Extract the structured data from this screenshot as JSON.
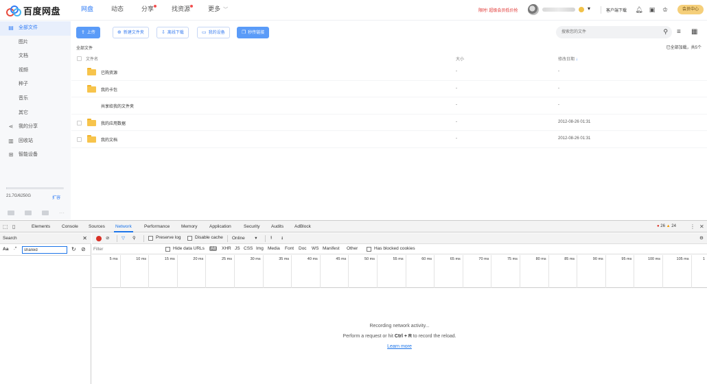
{
  "app": {
    "logo_text": "百度网盘",
    "nav": [
      {
        "label": "网盘",
        "active": true,
        "dot": false
      },
      {
        "label": "动态",
        "active": false,
        "dot": false
      },
      {
        "label": "分享",
        "active": false,
        "dot": true
      },
      {
        "label": "找资源",
        "active": false,
        "dot": true
      },
      {
        "label": "更多",
        "active": false,
        "dot": false
      }
    ],
    "promo_text": "限时! 超级会员低价抢",
    "client_download": "客户端下载",
    "member_center": "会员中心"
  },
  "sidebar": {
    "items": [
      {
        "label": "全部文件",
        "icon": "folder-icon",
        "active": true
      },
      {
        "label": "图片",
        "icon": "",
        "active": false
      },
      {
        "label": "文档",
        "icon": "",
        "active": false
      },
      {
        "label": "视频",
        "icon": "",
        "active": false
      },
      {
        "label": "种子",
        "icon": "",
        "active": false
      },
      {
        "label": "音乐",
        "icon": "",
        "active": false
      },
      {
        "label": "其它",
        "icon": "",
        "active": false
      },
      {
        "label": "我的分享",
        "icon": "share-icon",
        "active": false
      },
      {
        "label": "回收站",
        "icon": "trash-icon",
        "active": false
      },
      {
        "label": "智能设备",
        "icon": "device-icon",
        "active": false
      }
    ],
    "storage_text": "21.7G/6250G",
    "storage_fraction": 0.0035,
    "expand_label": "扩容"
  },
  "toolbar": {
    "upload": "上传",
    "new_folder": "新建文件夹",
    "offline_download": "离线下载",
    "my_devices": "我的设备",
    "instant_link": "秒传链接",
    "search_placeholder": "搜索您的文件"
  },
  "files": {
    "breadcrumb": "全部文件",
    "loaded_text": "已全部加载，共5个",
    "headers": {
      "name": "文件名",
      "size": "大小",
      "date": "修改日期"
    },
    "rows": [
      {
        "name": "已购资源",
        "size": "-",
        "date": "-",
        "folder": true,
        "checkbox": false
      },
      {
        "name": "我的卡包",
        "size": "-",
        "date": "-",
        "folder": true,
        "checkbox": false
      },
      {
        "name": "共享给我的文件夹",
        "size": "-",
        "date": "-",
        "folder": false,
        "checkbox": false
      },
      {
        "name": "我的应用数据",
        "size": "-",
        "date": "2012-08-26 01:31",
        "folder": true,
        "checkbox": true
      },
      {
        "name": "我的文档",
        "size": "-",
        "date": "2012-08-26 01:31",
        "folder": true,
        "checkbox": true
      }
    ]
  },
  "devtools": {
    "tabs": [
      "Elements",
      "Console",
      "Sources",
      "Network",
      "Performance",
      "Memory",
      "Application",
      "Security",
      "Audits",
      "AdBlock"
    ],
    "active_tab": "Network",
    "errors": "26",
    "warnings": "24",
    "search_title": "Search",
    "search_aa": "Aa",
    "search_regex": ".*",
    "search_value": "shareid",
    "preserve_log": "Preserve log",
    "disable_cache": "Disable cache",
    "throttle": "Online",
    "filter_placeholder": "Filter",
    "hide_data_urls": "Hide data URLs",
    "filter_types": [
      "All",
      "XHR",
      "JS",
      "CSS",
      "Img",
      "Media",
      "Font",
      "Doc",
      "WS",
      "Manifest",
      "Other"
    ],
    "has_blocked_cookies": "Has blocked cookies",
    "timeline_ticks": [
      "5 ms",
      "10 ms",
      "15 ms",
      "20 ms",
      "25 ms",
      "30 ms",
      "35 ms",
      "40 ms",
      "45 ms",
      "50 ms",
      "55 ms",
      "60 ms",
      "65 ms",
      "70 ms",
      "75 ms",
      "80 ms",
      "85 ms",
      "90 ms",
      "95 ms",
      "100 ms",
      "105 ms",
      "1"
    ],
    "empty_line1": "Recording network activity...",
    "empty_line2_pre": "Perform a request or hit ",
    "empty_line2_keys": "Ctrl + R",
    "empty_line2_post": " to record the reload.",
    "learn_more": "Learn more"
  }
}
